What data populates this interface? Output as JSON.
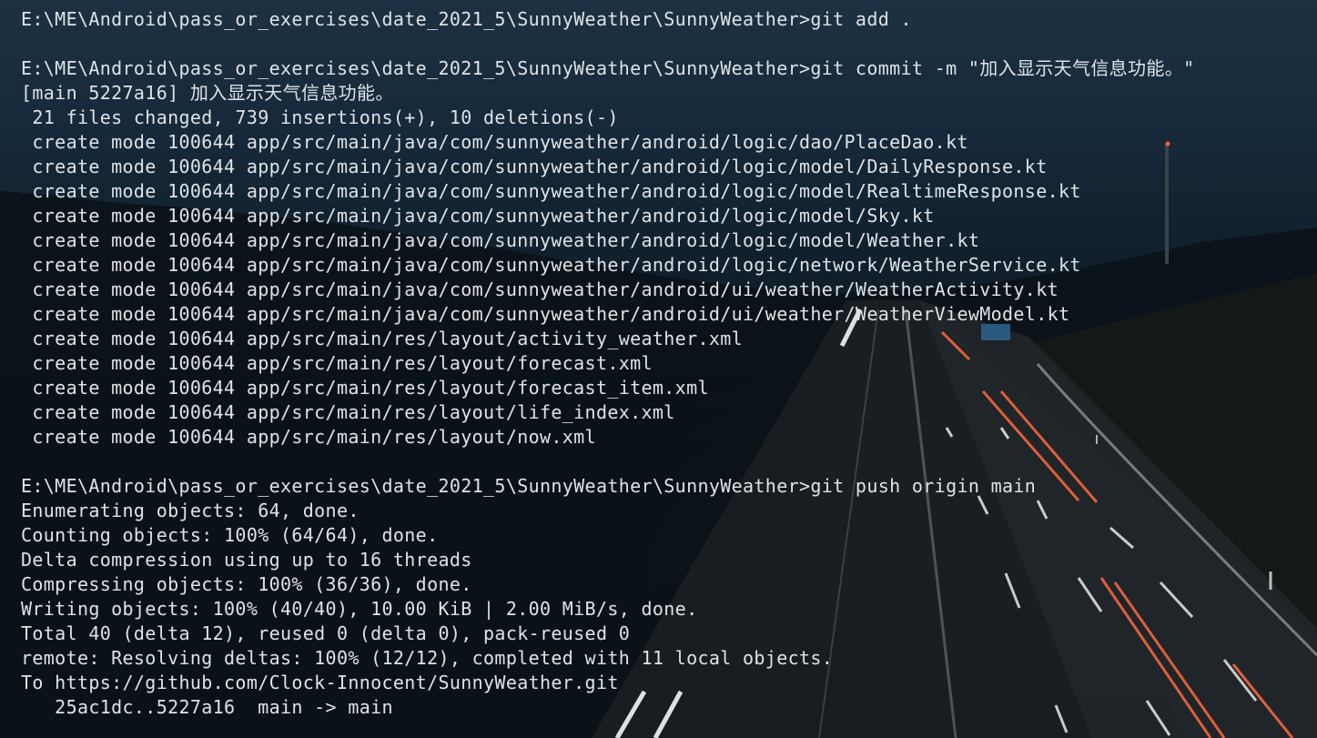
{
  "terminal": {
    "lines": [
      "E:\\ME\\Android\\pass_or_exercises\\date_2021_5\\SunnyWeather\\SunnyWeather>git add .",
      "",
      "E:\\ME\\Android\\pass_or_exercises\\date_2021_5\\SunnyWeather\\SunnyWeather>git commit -m \"加入显示天气信息功能。\"",
      "[main 5227a16] 加入显示天气信息功能。",
      " 21 files changed, 739 insertions(+), 10 deletions(-)",
      " create mode 100644 app/src/main/java/com/sunnyweather/android/logic/dao/PlaceDao.kt",
      " create mode 100644 app/src/main/java/com/sunnyweather/android/logic/model/DailyResponse.kt",
      " create mode 100644 app/src/main/java/com/sunnyweather/android/logic/model/RealtimeResponse.kt",
      " create mode 100644 app/src/main/java/com/sunnyweather/android/logic/model/Sky.kt",
      " create mode 100644 app/src/main/java/com/sunnyweather/android/logic/model/Weather.kt",
      " create mode 100644 app/src/main/java/com/sunnyweather/android/logic/network/WeatherService.kt",
      " create mode 100644 app/src/main/java/com/sunnyweather/android/ui/weather/WeatherActivity.kt",
      " create mode 100644 app/src/main/java/com/sunnyweather/android/ui/weather/WeatherViewModel.kt",
      " create mode 100644 app/src/main/res/layout/activity_weather.xml",
      " create mode 100644 app/src/main/res/layout/forecast.xml",
      " create mode 100644 app/src/main/res/layout/forecast_item.xml",
      " create mode 100644 app/src/main/res/layout/life_index.xml",
      " create mode 100644 app/src/main/res/layout/now.xml",
      "",
      "E:\\ME\\Android\\pass_or_exercises\\date_2021_5\\SunnyWeather\\SunnyWeather>git push origin main",
      "Enumerating objects: 64, done.",
      "Counting objects: 100% (64/64), done.",
      "Delta compression using up to 16 threads",
      "Compressing objects: 100% (36/36), done.",
      "Writing objects: 100% (40/40), 10.00 KiB | 2.00 MiB/s, done.",
      "Total 40 (delta 12), reused 0 (delta 0), pack-reused 0",
      "remote: Resolving deltas: 100% (12/12), completed with 11 local objects.",
      "To https://github.com/Clock-Innocent/SunnyWeather.git",
      "   25ac1dc..5227a16  main -> main"
    ],
    "colors": {
      "text": "#dfe3e7",
      "background": "#0c1a24",
      "light_trail": "#ff6a3d",
      "lane_marking": "#e8e8e8"
    },
    "background_image": "night-highway-light-trails"
  }
}
